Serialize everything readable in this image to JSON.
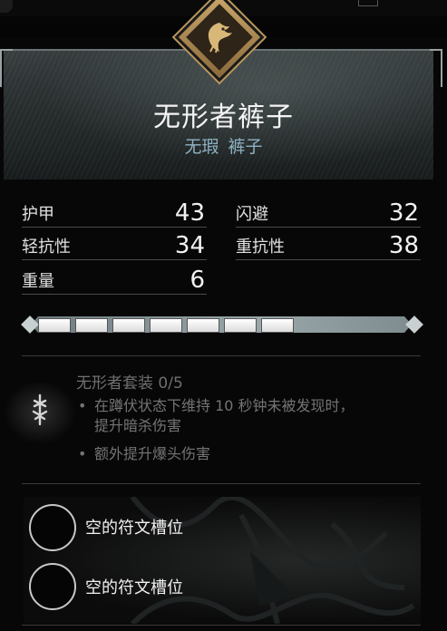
{
  "item": {
    "name": "无形者裤子",
    "subtitle": "无瑕 裤子",
    "emblem_icon": "raven-icon"
  },
  "stats": [
    {
      "label": "护甲",
      "value": "43"
    },
    {
      "label": "闪避",
      "value": "32"
    },
    {
      "label": "轻抗性",
      "value": "34"
    },
    {
      "label": "重抗性",
      "value": "38"
    },
    {
      "label": "重量",
      "value": "6"
    }
  ],
  "upgrade": {
    "filled_segments": 7,
    "level_icon": "upgrade-segment"
  },
  "set_bonus": {
    "title": "无形者套装 0/5",
    "icon": "rune-icon",
    "bullets": [
      {
        "line1": "在蹲伏状态下维持 10 秒钟未被发现时，",
        "line2": "提升暗杀伤害"
      },
      {
        "line1": "额外提升爆头伤害",
        "line2": ""
      }
    ]
  },
  "runes": {
    "slots": [
      {
        "label": "空的符文槽位"
      },
      {
        "label": "空的符文槽位"
      }
    ]
  },
  "colors": {
    "subtitle": "#8fb3c4",
    "emblem_gold": "#c9a56a",
    "set_text": "#747474"
  }
}
